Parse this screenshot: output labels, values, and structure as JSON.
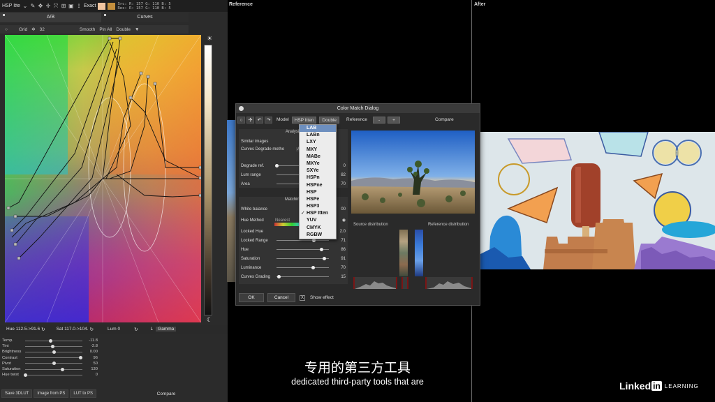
{
  "topbar": {
    "mode": "HSP Itte",
    "exact": "Exact",
    "src": "Src: R: 157   G: 110   B:   5",
    "res": "Res: R: 157   G: 110   B:   5",
    "swatch1": "#f1c5a0",
    "swatch2": "#c48f3d"
  },
  "tabs": {
    "ab": "A/B",
    "curves": "Curves"
  },
  "toolrow": {
    "grid": "Grid",
    "grid_value": "32",
    "smooth": "Smooth",
    "pin_all": "Pin All",
    "double": "Double"
  },
  "hueinfo": {
    "hue": "Hue 112.5->91.6",
    "sat": "Sat 117.0->104.",
    "lum": "Lum  0",
    "l": "L",
    "gamma": "Gamma"
  },
  "sliders": [
    {
      "label": "Temp.",
      "value": "-11.8",
      "pos": 0.44
    },
    {
      "label": "Tint",
      "value": "-2.8",
      "pos": 0.48
    },
    {
      "label": "Brightness",
      "value": "0.00",
      "pos": 0.5
    },
    {
      "label": "Contrast",
      "value": "96",
      "pos": 0.97
    },
    {
      "label": "Pivot",
      "value": "50",
      "pos": 0.5
    },
    {
      "label": "Saturation",
      "value": "130",
      "pos": 0.65
    },
    {
      "label": "Hue twist",
      "value": "0",
      "pos": 0.0
    }
  ],
  "bottom_buttons": {
    "save3dlut": "Save 3DLUT",
    "image_from_ps": "Image from PS",
    "lut_to_ps": "LUT to PS",
    "compare": "Compare"
  },
  "panels": {
    "reference": "Reference",
    "after": "After"
  },
  "dialog": {
    "title": "Color Match Dialog",
    "model_label": "Model",
    "model_value": "HSP Itten",
    "double": "Double",
    "reference": "Reference",
    "minus": "-",
    "plus": "+",
    "compare": "Compare",
    "analysis": {
      "header": "Analysis",
      "similar_images": "Similar images",
      "curves_degrade": "Curves Degrade metho",
      "curves_degrade_value": "A",
      "rows": [
        {
          "label": "Degrade ref.",
          "value": "0",
          "pos": 0.0
        },
        {
          "label": "Lum range",
          "value": "82",
          "pos": 0.82
        },
        {
          "label": "Area",
          "value": "70",
          "pos": 0.7
        }
      ]
    },
    "matching": {
      "header": "Matching",
      "white_balance": "White balance",
      "white_balance_value": "00",
      "hue_method": "Hue Method",
      "hue_method_value": "Nearest",
      "locked_hue": "Locked Hue",
      "locked_hue_value": "2.0",
      "rows": [
        {
          "label": "Locked Range",
          "value": "71",
          "pos": 0.71
        },
        {
          "label": "Hue",
          "value": "86",
          "pos": 0.86
        },
        {
          "label": "Saturation",
          "value": "91",
          "pos": 0.91
        },
        {
          "label": "Luminance",
          "value": "70",
          "pos": 0.7
        },
        {
          "label": "Curves Grading",
          "value": "15",
          "pos": 0.05
        }
      ]
    },
    "ok": "OK",
    "cancel": "Cancel",
    "show_effect": "Show effect",
    "show_effect_checked": "X",
    "source_distribution": "Source distribution",
    "reference_distribution": "Reference distribution"
  },
  "dropdown": {
    "items": [
      "LAB",
      "LABn",
      "LXY",
      "MXY",
      "MABe",
      "MXYe",
      "SXYe",
      "HSPn",
      "HSPne",
      "HSP",
      "HSPe",
      "HSP3",
      "HSP Itten",
      "YUV",
      "CMYK",
      "RGBW"
    ],
    "highlighted": "LAB",
    "checked": "HSP Itten"
  },
  "subtitles": {
    "cn": "专用的第三方工具",
    "en": "dedicated third-party tools that are"
  },
  "logo": {
    "linked": "Linked",
    "in": "in",
    "learning": "LEARNING"
  },
  "icons": {
    "sun": "sun-icon",
    "moon": "moon-icon"
  }
}
